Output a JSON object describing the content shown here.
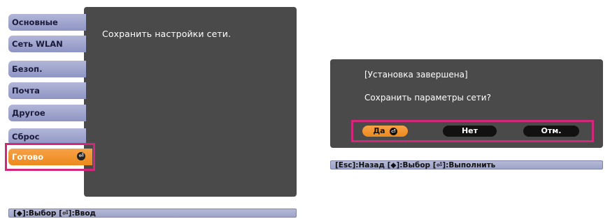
{
  "left": {
    "menu": [
      {
        "label": "Основные"
      },
      {
        "label": "Сеть WLAN"
      },
      {
        "label": "Безоп."
      },
      {
        "label": "Почта"
      },
      {
        "label": "Другое"
      },
      {
        "label": "Сброс"
      },
      {
        "label": "Готово",
        "active": true
      }
    ],
    "message": "Сохранить настройки сети.",
    "hint": "[◆]:Выбор [⏎]:Ввод"
  },
  "right": {
    "title": "[Установка завершена]",
    "question": "Сохранить параметры сети?",
    "buttons": {
      "yes": "Да",
      "no": "Нет",
      "cancel": "Отм."
    },
    "hint": "[Esc]:Назад [◆]:Выбор [⏎]:Выполнить"
  },
  "colors": {
    "panel": "#4a4a4a",
    "menu_item": "#9ea3c9",
    "active": "#f0921f",
    "highlight": "#d2287a"
  }
}
